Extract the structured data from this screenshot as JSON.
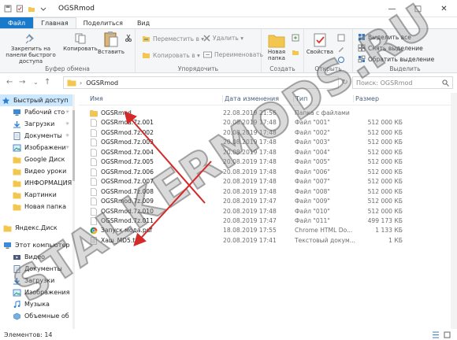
{
  "window": {
    "title": "OGSRmod"
  },
  "ribbon_tabs": [
    "Файл",
    "Главная",
    "Поделиться",
    "Вид"
  ],
  "ribbon": {
    "clipboard": {
      "pin": "Закрепить на панели быстрого доступа",
      "copy": "Копировать",
      "paste": "Вставить",
      "label": "Буфер обмена"
    },
    "organize": {
      "move_to": "Переместить в",
      "copy_to": "Копировать в",
      "delete": "Удалить",
      "rename": "Переименовать",
      "label": "Упорядочить"
    },
    "create": {
      "new_folder": "Новая папка",
      "label": "Создать"
    },
    "open": {
      "properties": "Свойства",
      "label": "Открыть"
    },
    "select": {
      "select_all": "Выделить все",
      "select_none": "Снять выделение",
      "invert": "Обратить выделение",
      "label": "Выделить"
    }
  },
  "address": {
    "path_item": "OGSRmod",
    "search_placeholder": "Поиск: OGSRmod"
  },
  "nav": {
    "items": [
      {
        "label": "Быстрый доступ",
        "icon": "star-icon"
      },
      {
        "label": "Рабочий сто",
        "icon": "desktop-icon"
      },
      {
        "label": "Загрузки",
        "icon": "download-icon"
      },
      {
        "label": "Документы",
        "icon": "documents-icon"
      },
      {
        "label": "Изображени",
        "icon": "pictures-icon"
      },
      {
        "label": "Google Диск",
        "icon": "folder-icon"
      },
      {
        "label": "Видео уроки",
        "icon": "folder-icon"
      },
      {
        "label": "ИНФОРМАЦИЯ",
        "icon": "folder-icon"
      },
      {
        "label": "Картинки",
        "icon": "folder-icon"
      },
      {
        "label": "Новая папка",
        "icon": "folder-icon"
      },
      {
        "label": "Яндекс.Диск",
        "icon": "folder-icon"
      },
      {
        "label": "Этот компьютер",
        "icon": "computer-icon"
      },
      {
        "label": "Видео",
        "icon": "video-icon"
      },
      {
        "label": "Документы",
        "icon": "documents-icon"
      },
      {
        "label": "Загрузки",
        "icon": "download-icon"
      },
      {
        "label": "Изображения",
        "icon": "pictures-icon"
      },
      {
        "label": "Музыка",
        "icon": "music-icon"
      },
      {
        "label": "Объемные об",
        "icon": "3d-objects-icon"
      }
    ]
  },
  "columns": {
    "name": "Имя",
    "date": "Дата изменения",
    "type": "Тип",
    "size": "Размер"
  },
  "files": [
    {
      "name": "OGSRmod",
      "date": "22.08.2019 21:56",
      "type": "Папка с файлами",
      "size": "",
      "icon": "folder-icon"
    },
    {
      "name": "OGSRmod.7z.001",
      "date": "20.08.2019 17:48",
      "type": "Файл \"001\"",
      "size": "512 000 КБ",
      "icon": "file-icon"
    },
    {
      "name": "OGSRmod.7z.002",
      "date": "20.08.2019 17:48",
      "type": "Файл \"002\"",
      "size": "512 000 КБ",
      "icon": "file-icon"
    },
    {
      "name": "OGSRmod.7z.003",
      "date": "20.08.2019 17:48",
      "type": "Файл \"003\"",
      "size": "512 000 КБ",
      "icon": "file-icon"
    },
    {
      "name": "OGSRmod.7z.004",
      "date": "20.08.2019 17:48",
      "type": "Файл \"004\"",
      "size": "512 000 КБ",
      "icon": "file-icon"
    },
    {
      "name": "OGSRmod.7z.005",
      "date": "20.08.2019 17:48",
      "type": "Файл \"005\"",
      "size": "512 000 КБ",
      "icon": "file-icon"
    },
    {
      "name": "OGSRmod.7z.006",
      "date": "20.08.2019 17:48",
      "type": "Файл \"006\"",
      "size": "512 000 КБ",
      "icon": "file-icon"
    },
    {
      "name": "OGSRmod.7z.007",
      "date": "20.08.2019 17:48",
      "type": "Файл \"007\"",
      "size": "512 000 КБ",
      "icon": "file-icon"
    },
    {
      "name": "OGSRmod.7z.008",
      "date": "20.08.2019 17:48",
      "type": "Файл \"008\"",
      "size": "512 000 КБ",
      "icon": "file-icon"
    },
    {
      "name": "OGSRmod.7z.009",
      "date": "20.08.2019 17:47",
      "type": "Файл \"009\"",
      "size": "512 000 КБ",
      "icon": "file-icon"
    },
    {
      "name": "OGSRmod.7z.010",
      "date": "20.08.2019 17:48",
      "type": "Файл \"010\"",
      "size": "512 000 КБ",
      "icon": "file-icon"
    },
    {
      "name": "OGSRmod.7z.011",
      "date": "20.08.2019 17:47",
      "type": "Файл \"011\"",
      "size": "499 173 КБ",
      "icon": "file-icon"
    },
    {
      "name": "Запуск мода.pdf",
      "date": "18.08.2019 17:55",
      "type": "Chrome HTML Do...",
      "size": "1 133 КБ",
      "icon": "pdf-icon"
    },
    {
      "name": "Хаш_MD5.txt",
      "date": "20.08.2019 17:41",
      "type": "Текстовый докум...",
      "size": "1 КБ",
      "icon": "text-file-icon"
    }
  ],
  "status": {
    "count": "Элементов: 14"
  },
  "watermark": "STALKERMODS.RU",
  "colors": {
    "accent": "#1979ca",
    "selection": "#cce8ff",
    "folder": "#f3c74f",
    "annotation": "#d42a2a"
  }
}
